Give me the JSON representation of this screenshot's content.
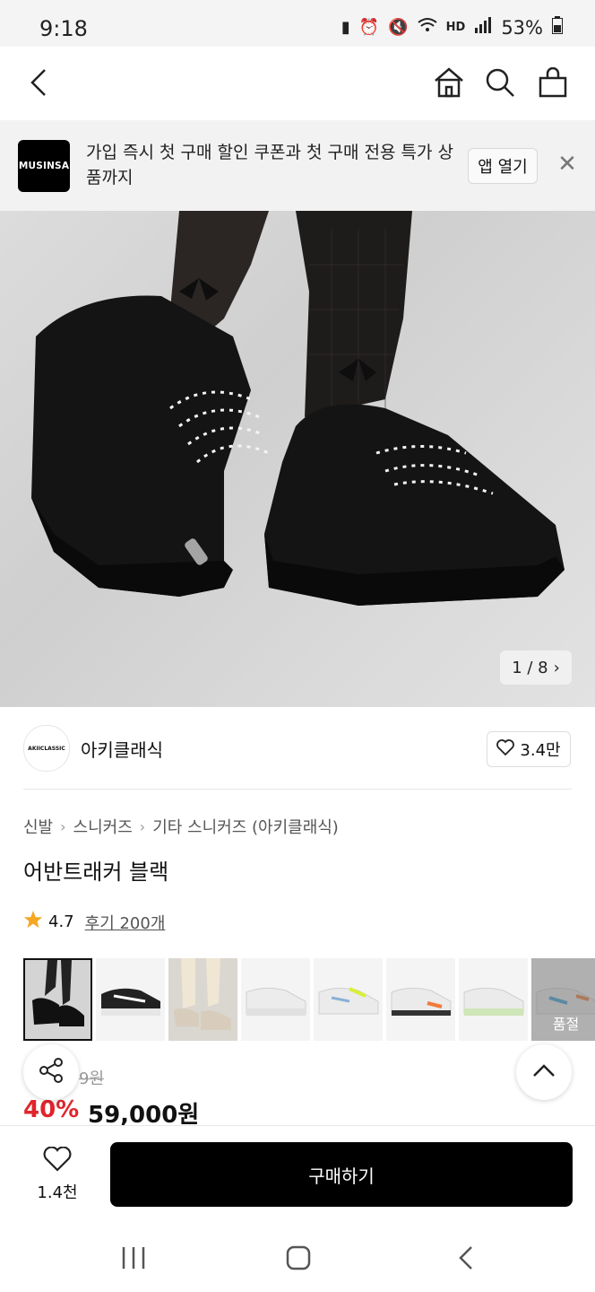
{
  "status_bar": {
    "time": "9:18",
    "battery": "53%",
    "network": "HD"
  },
  "banner": {
    "logo_text": "MUSINSA",
    "text": "가입 즉시 첫 구매 할인 쿠폰과 첫 구매 전용 특가 상품까지",
    "open_app_label": "앱 열기",
    "close_icon": "close-icon"
  },
  "gallery": {
    "counter": "1 / 8"
  },
  "brand": {
    "logo_text": "AKIICLASSIC",
    "name": "아키클래식",
    "likes": "3.4만"
  },
  "breadcrumb": [
    "신발",
    "스니커즈",
    "기타 스니커즈 (아키클래식)"
  ],
  "product": {
    "title": "어반트래커 블랙",
    "rating": "4.7",
    "reviews_label": "후기 200개"
  },
  "thumbnails": [
    {
      "color": "black",
      "selected": true
    },
    {
      "color": "black-white"
    },
    {
      "color": "beige"
    },
    {
      "color": "white"
    },
    {
      "color": "white-lime"
    },
    {
      "color": "white-orange"
    },
    {
      "color": "white-mint"
    },
    {
      "color": "white-blue",
      "soldout_label": "품절"
    }
  ],
  "price": {
    "original": "9원",
    "discount": "40%",
    "sale": "59,000원"
  },
  "bottom_bar": {
    "wish_count": "1.4천",
    "buy_label": "구매하기"
  },
  "colors": {
    "accent_red": "#e0252b",
    "buy_bg": "#000000"
  }
}
